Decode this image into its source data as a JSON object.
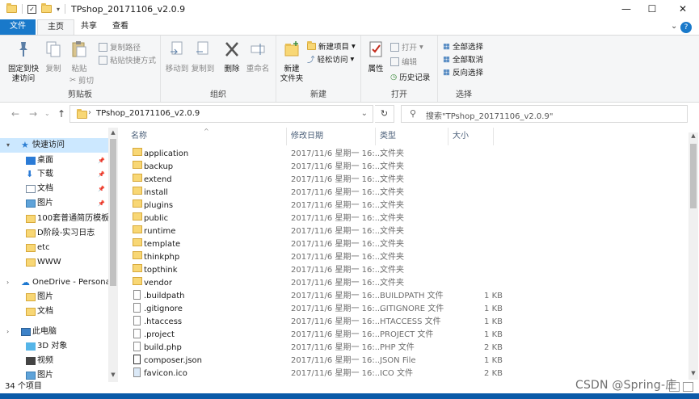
{
  "window": {
    "title": "TPshop_20171106_v2.0.9",
    "controls": {
      "minimize": "—",
      "maximize": "☐",
      "close": "✕"
    }
  },
  "ribbon_tabs": [
    {
      "label": "文件"
    },
    {
      "label": "主页"
    },
    {
      "label": "共享"
    },
    {
      "label": "查看"
    }
  ],
  "help_glyph": "?",
  "ribbon": {
    "clipboard": {
      "title": "剪贴板",
      "pin_l1": "固定到快",
      "pin_l2": "速访问",
      "copy": "复制",
      "paste": "粘贴",
      "copy_path": "复制路径",
      "paste_shortcut": "粘贴快捷方式",
      "cut": "剪切"
    },
    "organize": {
      "title": "组织",
      "move_to": "移动到",
      "copy_to": "复制到",
      "delete": "删除",
      "rename": "重命名"
    },
    "new": {
      "title": "新建",
      "new_item": "新建项目",
      "easy_access": "轻松访问",
      "new_folder_l1": "新建",
      "new_folder_l2": "文件夹"
    },
    "open": {
      "title": "打开",
      "properties": "属性",
      "open": "打开",
      "edit": "编辑",
      "history": "历史记录"
    },
    "select": {
      "title": "选择",
      "select_all": "全部选择",
      "select_none": "全部取消",
      "invert": "反向选择"
    }
  },
  "address": {
    "path": "TPshop_20171106_v2.0.9",
    "search_placeholder": "搜索\"TPshop_20171106_v2.0.9\""
  },
  "nav_pane": [
    {
      "label": "快速访问",
      "icon": "star-icon",
      "selected": true,
      "indent": 1,
      "pinned": false
    },
    {
      "label": "桌面",
      "icon": "desktop-icon",
      "selected": false,
      "indent": 2,
      "pinned": true
    },
    {
      "label": "下载",
      "icon": "download-icon",
      "selected": false,
      "indent": 2,
      "pinned": true
    },
    {
      "label": "文档",
      "icon": "documents-icon",
      "selected": false,
      "indent": 2,
      "pinned": true
    },
    {
      "label": "图片",
      "icon": "pictures-icon",
      "selected": false,
      "indent": 2,
      "pinned": true
    },
    {
      "label": "100套普通简历模板",
      "icon": "folder-icon",
      "selected": false,
      "indent": 2,
      "pinned": false
    },
    {
      "label": "D阶段-实习日志",
      "icon": "folder-icon",
      "selected": false,
      "indent": 2,
      "pinned": false
    },
    {
      "label": "etc",
      "icon": "folder-icon",
      "selected": false,
      "indent": 2,
      "pinned": false
    },
    {
      "label": "WWW",
      "icon": "folder-icon",
      "selected": false,
      "indent": 2,
      "pinned": false
    },
    {
      "label": "OneDrive - Personal",
      "icon": "cloud-icon",
      "selected": false,
      "indent": 1,
      "pinned": false
    },
    {
      "label": "图片",
      "icon": "folder-icon",
      "selected": false,
      "indent": 2,
      "pinned": false
    },
    {
      "label": "文档",
      "icon": "folder-icon",
      "selected": false,
      "indent": 2,
      "pinned": false
    },
    {
      "label": "此电脑",
      "icon": "computer-icon",
      "selected": false,
      "indent": 1,
      "pinned": false
    },
    {
      "label": "3D 对象",
      "icon": "3d-objects-icon",
      "selected": false,
      "indent": 2,
      "pinned": false
    },
    {
      "label": "视频",
      "icon": "videos-icon",
      "selected": false,
      "indent": 2,
      "pinned": false
    },
    {
      "label": "图片",
      "icon": "pictures-icon",
      "selected": false,
      "indent": 2,
      "pinned": false
    }
  ],
  "columns": {
    "name": "名称",
    "date": "修改日期",
    "type": "类型",
    "size": "大小"
  },
  "files": [
    {
      "name": "application",
      "date": "2017/11/6 星期一 16:...",
      "type": "文件夹",
      "size": "",
      "kind": "folder"
    },
    {
      "name": "backup",
      "date": "2017/11/6 星期一 16:...",
      "type": "文件夹",
      "size": "",
      "kind": "folder"
    },
    {
      "name": "extend",
      "date": "2017/11/6 星期一 16:...",
      "type": "文件夹",
      "size": "",
      "kind": "folder"
    },
    {
      "name": "install",
      "date": "2017/11/6 星期一 16:...",
      "type": "文件夹",
      "size": "",
      "kind": "folder"
    },
    {
      "name": "plugins",
      "date": "2017/11/6 星期一 16:...",
      "type": "文件夹",
      "size": "",
      "kind": "folder"
    },
    {
      "name": "public",
      "date": "2017/11/6 星期一 16:...",
      "type": "文件夹",
      "size": "",
      "kind": "folder"
    },
    {
      "name": "runtime",
      "date": "2017/11/6 星期一 16:...",
      "type": "文件夹",
      "size": "",
      "kind": "folder"
    },
    {
      "name": "template",
      "date": "2017/11/6 星期一 16:...",
      "type": "文件夹",
      "size": "",
      "kind": "folder"
    },
    {
      "name": "thinkphp",
      "date": "2017/11/6 星期一 16:...",
      "type": "文件夹",
      "size": "",
      "kind": "folder"
    },
    {
      "name": "topthink",
      "date": "2017/11/6 星期一 16:...",
      "type": "文件夹",
      "size": "",
      "kind": "folder"
    },
    {
      "name": "vendor",
      "date": "2017/11/6 星期一 16:...",
      "type": "文件夹",
      "size": "",
      "kind": "folder"
    },
    {
      "name": ".buildpath",
      "date": "2017/11/6 星期一 16:...",
      "type": "BUILDPATH 文件",
      "size": "1 KB",
      "kind": "file"
    },
    {
      "name": ".gitignore",
      "date": "2017/11/6 星期一 16:...",
      "type": "GITIGNORE 文件",
      "size": "1 KB",
      "kind": "file"
    },
    {
      "name": ".htaccess",
      "date": "2017/11/6 星期一 16:...",
      "type": "HTACCESS 文件",
      "size": "1 KB",
      "kind": "file"
    },
    {
      "name": ".project",
      "date": "2017/11/6 星期一 16:...",
      "type": "PROJECT 文件",
      "size": "1 KB",
      "kind": "file"
    },
    {
      "name": "build.php",
      "date": "2017/11/6 星期一 16:...",
      "type": "PHP 文件",
      "size": "2 KB",
      "kind": "file"
    },
    {
      "name": "composer.json",
      "date": "2017/11/6 星期一 16:...",
      "type": "JSON File",
      "size": "1 KB",
      "kind": "json"
    },
    {
      "name": "favicon.ico",
      "date": "2017/11/6 星期一 16:...",
      "type": "ICO 文件",
      "size": "2 KB",
      "kind": "image"
    }
  ],
  "status": {
    "count": "34 个项目"
  },
  "watermark": "CSDN @Spring-庄"
}
